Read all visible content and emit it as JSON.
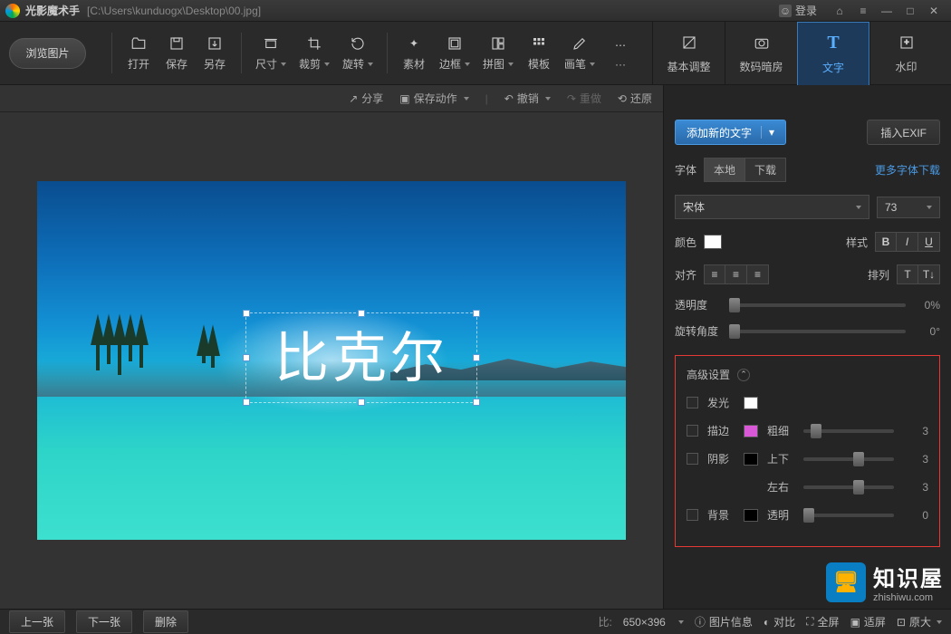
{
  "titlebar": {
    "app": "光影魔术手",
    "path": "[C:\\Users\\kunduogx\\Desktop\\00.jpg]",
    "login": "登录"
  },
  "toolbar": {
    "browse": "浏览图片",
    "open": "打开",
    "save": "保存",
    "saveas": "另存",
    "size": "尺寸",
    "crop": "裁剪",
    "rotate": "旋转",
    "material": "素材",
    "border": "边框",
    "collage": "拼图",
    "template": "模板",
    "brush": "画笔",
    "more": "···"
  },
  "rtabs": {
    "basic": "基本调整",
    "darkroom": "数码暗房",
    "text": "文字",
    "watermark": "水印"
  },
  "canvas_toolbar": {
    "share": "分享",
    "saveaction": "保存动作",
    "undo": "撤销",
    "redo": "重做",
    "restore": "还原"
  },
  "overlay_text": "比克尔",
  "right": {
    "add_text": "添加新的文字",
    "insert_exif": "插入EXIF",
    "font_label": "字体",
    "font_local": "本地",
    "font_download": "下载",
    "more_fonts": "更多字体下载",
    "font_family": "宋体",
    "font_size": "73",
    "color_label": "颜色",
    "style_label": "样式",
    "align_label": "对齐",
    "arrange_label": "排列",
    "opacity_label": "透明度",
    "opacity_val": "0%",
    "rotate_label": "旋转角度",
    "rotate_val": "0°",
    "advanced": "高级设置",
    "glow": "发光",
    "stroke": "描边",
    "stroke_width": "粗细",
    "stroke_val": "3",
    "shadow": "阴影",
    "shadow_v": "上下",
    "shadow_v_val": "3",
    "shadow_h": "左右",
    "shadow_h_val": "3",
    "bg": "背景",
    "bg_opacity": "透明",
    "bg_val": "0"
  },
  "status": {
    "prev": "上一张",
    "next": "下一张",
    "delete": "删除",
    "dims": "650×396",
    "info": "图片信息",
    "compare": "对比",
    "fullscreen": "全屏",
    "fit": "适屏",
    "orig": "原大"
  },
  "watermark": {
    "cn": "知识屋",
    "url": "zhishiwu.com"
  }
}
